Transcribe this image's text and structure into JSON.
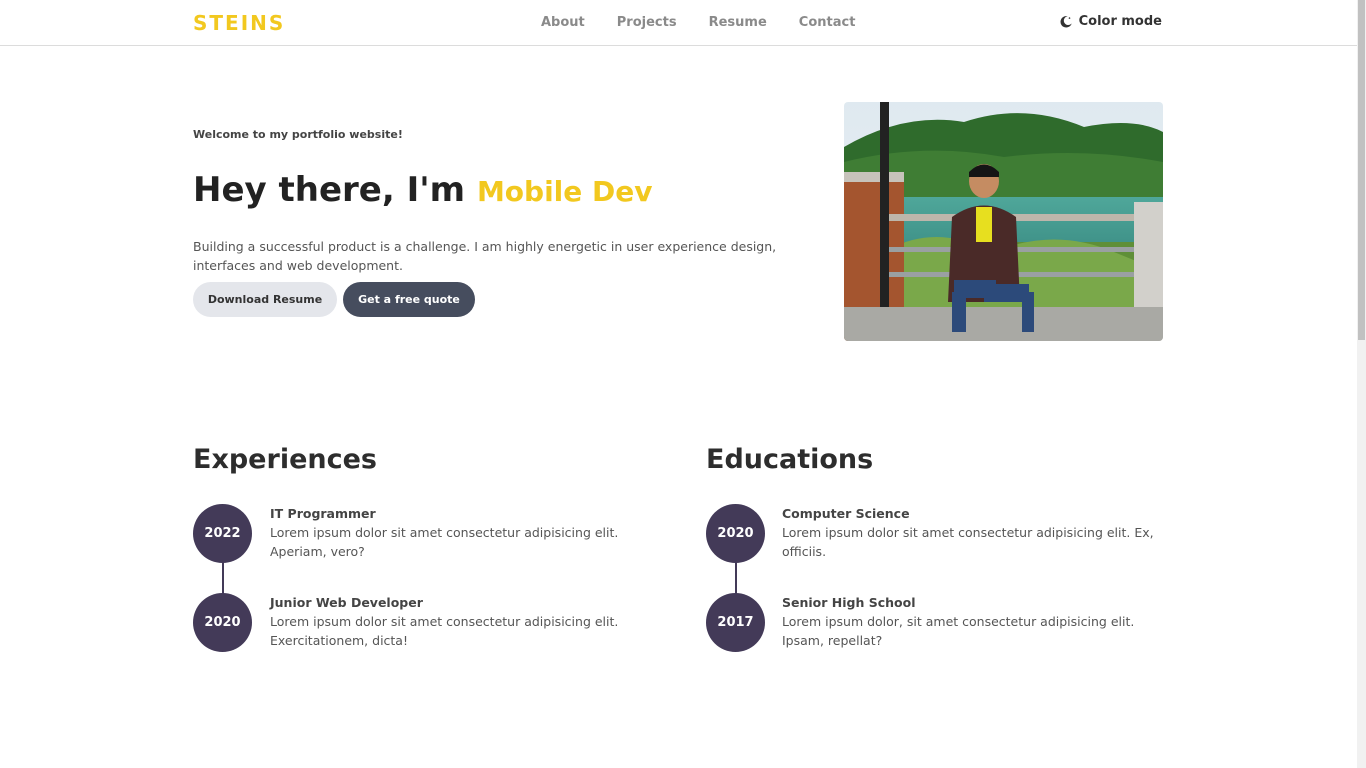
{
  "header": {
    "logo": "STEINS",
    "nav": [
      "About",
      "Projects",
      "Resume",
      "Contact"
    ],
    "color_mode_label": "Color mode"
  },
  "hero": {
    "welcome": "Welcome to my portfolio website!",
    "title_prefix": "Hey there, I'm ",
    "title_accent": "Mobile Dev",
    "description": "Building a successful product is a challenge. I am highly energetic in user experience design, interfaces and web development.",
    "download_label": "Download Resume",
    "quote_label": "Get a free quote"
  },
  "experiences": {
    "title": "Experiences",
    "items": [
      {
        "year": "2022",
        "role": "IT Programmer",
        "text": "Lorem ipsum dolor sit amet consectetur adipisicing elit. Aperiam, vero?"
      },
      {
        "year": "2020",
        "role": "Junior Web Developer",
        "text": "Lorem ipsum dolor sit amet consectetur adipisicing elit. Exercitationem, dicta!"
      }
    ]
  },
  "educations": {
    "title": "Educations",
    "items": [
      {
        "year": "2020",
        "role": "Computer Science",
        "text": "Lorem ipsum dolor sit amet consectetur adipisicing elit. Ex, officiis."
      },
      {
        "year": "2017",
        "role": "Senior High School",
        "text": "Lorem ipsum dolor, sit amet consectetur adipisicing elit. Ipsam, repellat?"
      }
    ]
  },
  "colors": {
    "accent": "#f2c81f",
    "timeline": "#433a58",
    "button_dark": "#464d5e",
    "button_light": "#e4e6eb"
  }
}
